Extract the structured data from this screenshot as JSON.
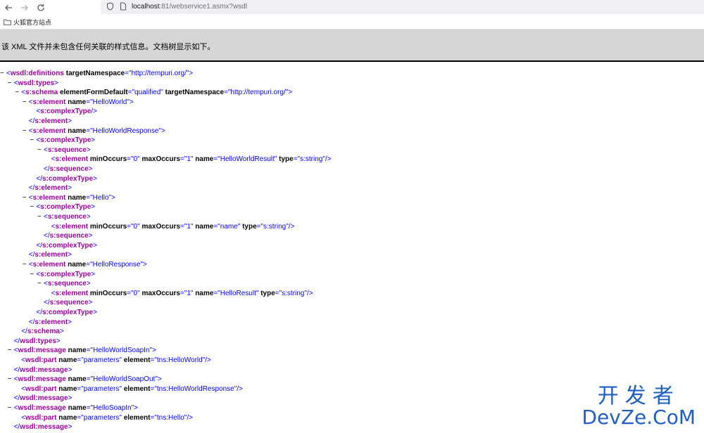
{
  "browser": {
    "url_host": "localhost",
    "url_path": ":81/webservice1.asmx?wsdl",
    "icons": [
      "back-arrow-icon",
      "forward-arrow-icon",
      "reload-icon",
      "shield-icon",
      "page-icon"
    ]
  },
  "bookmarks": {
    "items": [
      {
        "label": "火狐官方站点",
        "icon": "folder-icon"
      }
    ]
  },
  "notice": {
    "text": "该 XML 文件并未包含任何关联的样式信息。文档树显示如下。"
  },
  "xml_lines": [
    {
      "indent": 0,
      "toggle": "−",
      "parts": [
        [
          "p",
          "<"
        ],
        [
          "tag",
          "wsdl:definitions"
        ],
        [
          "sp",
          " "
        ],
        [
          "an",
          "targetNamespace"
        ],
        [
          "p",
          "=\""
        ],
        [
          "av",
          "http://tempuri.org/"
        ],
        [
          "p",
          "\">"
        ]
      ]
    },
    {
      "indent": 1,
      "toggle": "−",
      "parts": [
        [
          "p",
          "<"
        ],
        [
          "tag",
          "wsdl:types"
        ],
        [
          "p",
          ">"
        ]
      ]
    },
    {
      "indent": 2,
      "toggle": "−",
      "parts": [
        [
          "p",
          "<"
        ],
        [
          "tag",
          "s:schema"
        ],
        [
          "sp",
          " "
        ],
        [
          "an",
          "elementFormDefault"
        ],
        [
          "p",
          "=\""
        ],
        [
          "av",
          "qualified"
        ],
        [
          "p",
          "\" "
        ],
        [
          "an",
          "targetNamespace"
        ],
        [
          "p",
          "=\""
        ],
        [
          "av",
          "http://tempuri.org/"
        ],
        [
          "p",
          "\">"
        ]
      ]
    },
    {
      "indent": 3,
      "toggle": "−",
      "parts": [
        [
          "p",
          "<"
        ],
        [
          "tag",
          "s:element"
        ],
        [
          "sp",
          " "
        ],
        [
          "an",
          "name"
        ],
        [
          "p",
          "=\""
        ],
        [
          "av",
          "HelloWorld"
        ],
        [
          "p",
          "\">"
        ]
      ]
    },
    {
      "indent": 4,
      "toggle": "",
      "parts": [
        [
          "p",
          "<"
        ],
        [
          "tag",
          "s:complexType"
        ],
        [
          "p",
          "/>"
        ]
      ]
    },
    {
      "indent": 3,
      "toggle": "",
      "parts": [
        [
          "p",
          "</"
        ],
        [
          "tag",
          "s:element"
        ],
        [
          "p",
          ">"
        ]
      ]
    },
    {
      "indent": 3,
      "toggle": "−",
      "parts": [
        [
          "p",
          "<"
        ],
        [
          "tag",
          "s:element"
        ],
        [
          "sp",
          " "
        ],
        [
          "an",
          "name"
        ],
        [
          "p",
          "=\""
        ],
        [
          "av",
          "HelloWorldResponse"
        ],
        [
          "p",
          "\">"
        ]
      ]
    },
    {
      "indent": 4,
      "toggle": "−",
      "parts": [
        [
          "p",
          "<"
        ],
        [
          "tag",
          "s:complexType"
        ],
        [
          "p",
          ">"
        ]
      ]
    },
    {
      "indent": 5,
      "toggle": "−",
      "parts": [
        [
          "p",
          "<"
        ],
        [
          "tag",
          "s:sequence"
        ],
        [
          "p",
          ">"
        ]
      ]
    },
    {
      "indent": 6,
      "toggle": "",
      "parts": [
        [
          "p",
          "<"
        ],
        [
          "tag",
          "s:element"
        ],
        [
          "sp",
          " "
        ],
        [
          "an",
          "minOccurs"
        ],
        [
          "p",
          "=\""
        ],
        [
          "av",
          "0"
        ],
        [
          "p",
          "\" "
        ],
        [
          "an",
          "maxOccurs"
        ],
        [
          "p",
          "=\""
        ],
        [
          "av",
          "1"
        ],
        [
          "p",
          "\" "
        ],
        [
          "an",
          "name"
        ],
        [
          "p",
          "=\""
        ],
        [
          "av",
          "HelloWorldResult"
        ],
        [
          "p",
          "\" "
        ],
        [
          "an",
          "type"
        ],
        [
          "p",
          "=\""
        ],
        [
          "av",
          "s:string"
        ],
        [
          "p",
          "\"/>"
        ]
      ]
    },
    {
      "indent": 5,
      "toggle": "",
      "parts": [
        [
          "p",
          "</"
        ],
        [
          "tag",
          "s:sequence"
        ],
        [
          "p",
          ">"
        ]
      ]
    },
    {
      "indent": 4,
      "toggle": "",
      "parts": [
        [
          "p",
          "</"
        ],
        [
          "tag",
          "s:complexType"
        ],
        [
          "p",
          ">"
        ]
      ]
    },
    {
      "indent": 3,
      "toggle": "",
      "parts": [
        [
          "p",
          "</"
        ],
        [
          "tag",
          "s:element"
        ],
        [
          "p",
          ">"
        ]
      ]
    },
    {
      "indent": 3,
      "toggle": "−",
      "parts": [
        [
          "p",
          "<"
        ],
        [
          "tag",
          "s:element"
        ],
        [
          "sp",
          " "
        ],
        [
          "an",
          "name"
        ],
        [
          "p",
          "=\""
        ],
        [
          "av",
          "Hello"
        ],
        [
          "p",
          "\">"
        ]
      ]
    },
    {
      "indent": 4,
      "toggle": "−",
      "parts": [
        [
          "p",
          "<"
        ],
        [
          "tag",
          "s:complexType"
        ],
        [
          "p",
          ">"
        ]
      ]
    },
    {
      "indent": 5,
      "toggle": "−",
      "parts": [
        [
          "p",
          "<"
        ],
        [
          "tag",
          "s:sequence"
        ],
        [
          "p",
          ">"
        ]
      ]
    },
    {
      "indent": 6,
      "toggle": "",
      "parts": [
        [
          "p",
          "<"
        ],
        [
          "tag",
          "s:element"
        ],
        [
          "sp",
          " "
        ],
        [
          "an",
          "minOccurs"
        ],
        [
          "p",
          "=\""
        ],
        [
          "av",
          "0"
        ],
        [
          "p",
          "\" "
        ],
        [
          "an",
          "maxOccurs"
        ],
        [
          "p",
          "=\""
        ],
        [
          "av",
          "1"
        ],
        [
          "p",
          "\" "
        ],
        [
          "an",
          "name"
        ],
        [
          "p",
          "=\""
        ],
        [
          "av",
          "name"
        ],
        [
          "p",
          "\" "
        ],
        [
          "an",
          "type"
        ],
        [
          "p",
          "=\""
        ],
        [
          "av",
          "s:string"
        ],
        [
          "p",
          "\"/>"
        ]
      ]
    },
    {
      "indent": 5,
      "toggle": "",
      "parts": [
        [
          "p",
          "</"
        ],
        [
          "tag",
          "s:sequence"
        ],
        [
          "p",
          ">"
        ]
      ]
    },
    {
      "indent": 4,
      "toggle": "",
      "parts": [
        [
          "p",
          "</"
        ],
        [
          "tag",
          "s:complexType"
        ],
        [
          "p",
          ">"
        ]
      ]
    },
    {
      "indent": 3,
      "toggle": "",
      "parts": [
        [
          "p",
          "</"
        ],
        [
          "tag",
          "s:element"
        ],
        [
          "p",
          ">"
        ]
      ]
    },
    {
      "indent": 3,
      "toggle": "−",
      "parts": [
        [
          "p",
          "<"
        ],
        [
          "tag",
          "s:element"
        ],
        [
          "sp",
          " "
        ],
        [
          "an",
          "name"
        ],
        [
          "p",
          "=\""
        ],
        [
          "av",
          "HelloResponse"
        ],
        [
          "p",
          "\">"
        ]
      ]
    },
    {
      "indent": 4,
      "toggle": "−",
      "parts": [
        [
          "p",
          "<"
        ],
        [
          "tag",
          "s:complexType"
        ],
        [
          "p",
          ">"
        ]
      ]
    },
    {
      "indent": 5,
      "toggle": "−",
      "parts": [
        [
          "p",
          "<"
        ],
        [
          "tag",
          "s:sequence"
        ],
        [
          "p",
          ">"
        ]
      ]
    },
    {
      "indent": 6,
      "toggle": "",
      "parts": [
        [
          "p",
          "<"
        ],
        [
          "tag",
          "s:element"
        ],
        [
          "sp",
          " "
        ],
        [
          "an",
          "minOccurs"
        ],
        [
          "p",
          "=\""
        ],
        [
          "av",
          "0"
        ],
        [
          "p",
          "\" "
        ],
        [
          "an",
          "maxOccurs"
        ],
        [
          "p",
          "=\""
        ],
        [
          "av",
          "1"
        ],
        [
          "p",
          "\" "
        ],
        [
          "an",
          "name"
        ],
        [
          "p",
          "=\""
        ],
        [
          "av",
          "HelloResult"
        ],
        [
          "p",
          "\" "
        ],
        [
          "an",
          "type"
        ],
        [
          "p",
          "=\""
        ],
        [
          "av",
          "s:string"
        ],
        [
          "p",
          "\"/>"
        ]
      ]
    },
    {
      "indent": 5,
      "toggle": "",
      "parts": [
        [
          "p",
          "</"
        ],
        [
          "tag",
          "s:sequence"
        ],
        [
          "p",
          ">"
        ]
      ]
    },
    {
      "indent": 4,
      "toggle": "",
      "parts": [
        [
          "p",
          "</"
        ],
        [
          "tag",
          "s:complexType"
        ],
        [
          "p",
          ">"
        ]
      ]
    },
    {
      "indent": 3,
      "toggle": "",
      "parts": [
        [
          "p",
          "</"
        ],
        [
          "tag",
          "s:element"
        ],
        [
          "p",
          ">"
        ]
      ]
    },
    {
      "indent": 2,
      "toggle": "",
      "parts": [
        [
          "p",
          "</"
        ],
        [
          "tag",
          "s:schema"
        ],
        [
          "p",
          ">"
        ]
      ]
    },
    {
      "indent": 1,
      "toggle": "",
      "parts": [
        [
          "p",
          "</"
        ],
        [
          "tag",
          "wsdl:types"
        ],
        [
          "p",
          ">"
        ]
      ]
    },
    {
      "indent": 1,
      "toggle": "−",
      "parts": [
        [
          "p",
          "<"
        ],
        [
          "tag",
          "wsdl:message"
        ],
        [
          "sp",
          " "
        ],
        [
          "an",
          "name"
        ],
        [
          "p",
          "=\""
        ],
        [
          "av",
          "HelloWorldSoapIn"
        ],
        [
          "p",
          "\">"
        ]
      ]
    },
    {
      "indent": 2,
      "toggle": "",
      "parts": [
        [
          "p",
          "<"
        ],
        [
          "tag",
          "wsdl:part"
        ],
        [
          "sp",
          " "
        ],
        [
          "an",
          "name"
        ],
        [
          "p",
          "=\""
        ],
        [
          "av",
          "parameters"
        ],
        [
          "p",
          "\" "
        ],
        [
          "an",
          "element"
        ],
        [
          "p",
          "=\""
        ],
        [
          "av",
          "tns:HelloWorld"
        ],
        [
          "p",
          "\"/>"
        ]
      ]
    },
    {
      "indent": 1,
      "toggle": "",
      "parts": [
        [
          "p",
          "</"
        ],
        [
          "tag",
          "wsdl:message"
        ],
        [
          "p",
          ">"
        ]
      ]
    },
    {
      "indent": 1,
      "toggle": "−",
      "parts": [
        [
          "p",
          "<"
        ],
        [
          "tag",
          "wsdl:message"
        ],
        [
          "sp",
          " "
        ],
        [
          "an",
          "name"
        ],
        [
          "p",
          "=\""
        ],
        [
          "av",
          "HelloWorldSoapOut"
        ],
        [
          "p",
          "\">"
        ]
      ]
    },
    {
      "indent": 2,
      "toggle": "",
      "parts": [
        [
          "p",
          "<"
        ],
        [
          "tag",
          "wsdl:part"
        ],
        [
          "sp",
          " "
        ],
        [
          "an",
          "name"
        ],
        [
          "p",
          "=\""
        ],
        [
          "av",
          "parameters"
        ],
        [
          "p",
          "\" "
        ],
        [
          "an",
          "element"
        ],
        [
          "p",
          "=\""
        ],
        [
          "av",
          "tns:HelloWorldResponse"
        ],
        [
          "p",
          "\"/>"
        ]
      ]
    },
    {
      "indent": 1,
      "toggle": "",
      "parts": [
        [
          "p",
          "</"
        ],
        [
          "tag",
          "wsdl:message"
        ],
        [
          "p",
          ">"
        ]
      ]
    },
    {
      "indent": 1,
      "toggle": "−",
      "parts": [
        [
          "p",
          "<"
        ],
        [
          "tag",
          "wsdl:message"
        ],
        [
          "sp",
          " "
        ],
        [
          "an",
          "name"
        ],
        [
          "p",
          "=\""
        ],
        [
          "av",
          "HelloSoapIn"
        ],
        [
          "p",
          "\">"
        ]
      ]
    },
    {
      "indent": 2,
      "toggle": "",
      "parts": [
        [
          "p",
          "<"
        ],
        [
          "tag",
          "wsdl:part"
        ],
        [
          "sp",
          " "
        ],
        [
          "an",
          "name"
        ],
        [
          "p",
          "=\""
        ],
        [
          "av",
          "parameters"
        ],
        [
          "p",
          "\" "
        ],
        [
          "an",
          "element"
        ],
        [
          "p",
          "=\""
        ],
        [
          "av",
          "tns:Hello"
        ],
        [
          "p",
          "\"/>"
        ]
      ]
    },
    {
      "indent": 1,
      "toggle": "",
      "parts": [
        [
          "p",
          "</"
        ],
        [
          "tag",
          "wsdl:message"
        ],
        [
          "p",
          ">"
        ]
      ]
    }
  ],
  "watermark": {
    "line1": "开发者",
    "line2": "DevZe.CoM"
  }
}
